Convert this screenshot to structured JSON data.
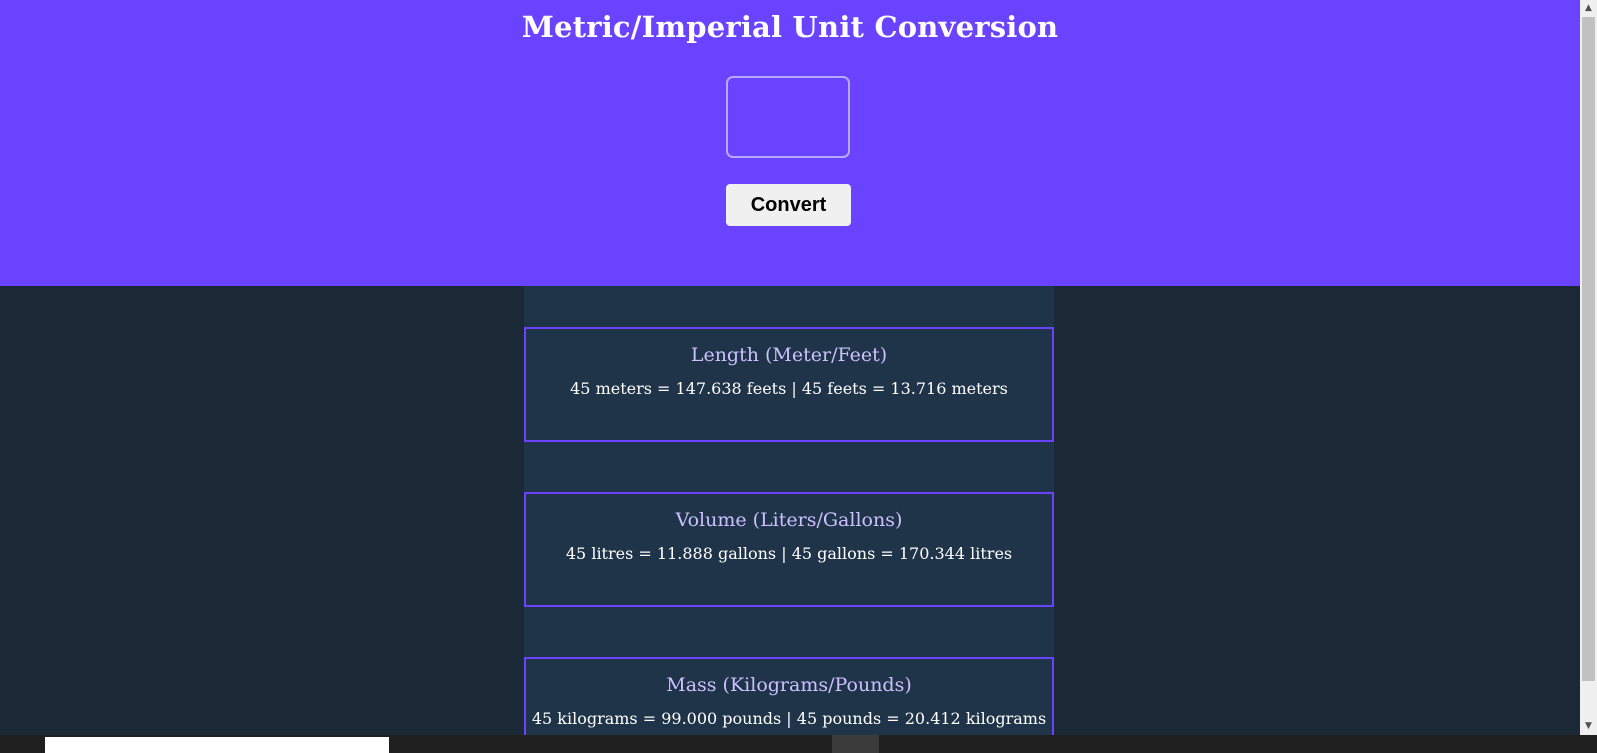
{
  "header": {
    "title": "Metric/Imperial Unit Conversion"
  },
  "input": {
    "value": ""
  },
  "convert_button": {
    "label": "Convert"
  },
  "cards": [
    {
      "title": "Length (Meter/Feet)",
      "text": "45 meters = 147.638 feets | 45 feets = 13.716 meters"
    },
    {
      "title": "Volume (Liters/Gallons)",
      "text": "45 litres = 11.888 gallons | 45 gallons = 170.344 litres"
    },
    {
      "title": "Mass (Kilograms/Pounds)",
      "text": "45 kilograms = 99.000 pounds | 45 pounds = 20.412 kilograms"
    }
  ],
  "colors": {
    "header_bg": "#6943ff",
    "page_bg": "#1b2836",
    "card_bg": "#1f3449",
    "card_border": "#6943ff",
    "card_title": "#ccc1ff"
  }
}
